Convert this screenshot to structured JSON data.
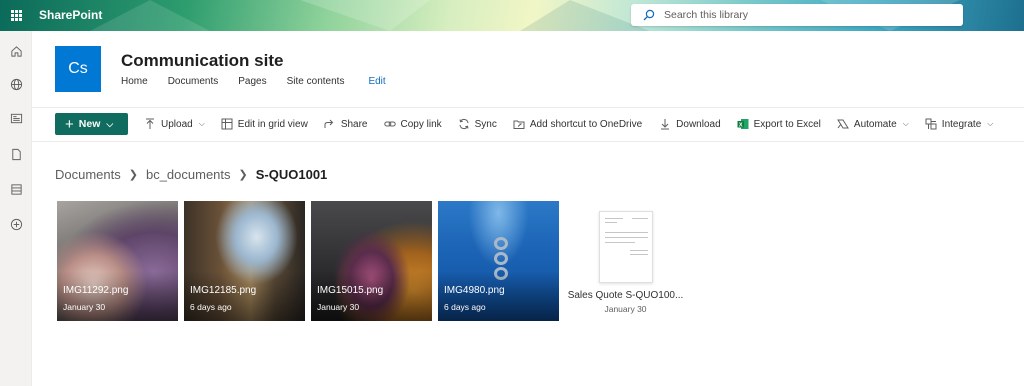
{
  "suite": {
    "brand": "SharePoint",
    "search_placeholder": "Search this library"
  },
  "site": {
    "logo": "Cs",
    "title": "Communication site",
    "nav": [
      "Home",
      "Documents",
      "Pages",
      "Site contents"
    ],
    "edit": "Edit"
  },
  "toolbar": {
    "new": "New",
    "upload": "Upload",
    "grid_view": "Edit in grid view",
    "share": "Share",
    "copy_link": "Copy link",
    "sync": "Sync",
    "add_shortcut": "Add shortcut to OneDrive",
    "download": "Download",
    "export_excel": "Export to Excel",
    "automate": "Automate",
    "integrate": "Integrate"
  },
  "breadcrumb": [
    "Documents",
    "bc_documents",
    "S-QUO1001"
  ],
  "files": [
    {
      "name": "IMG11292.png",
      "date": "January 30"
    },
    {
      "name": "IMG12185.png",
      "date": "6 days ago"
    },
    {
      "name": "IMG15015.png",
      "date": "January 30"
    },
    {
      "name": "IMG4980.png",
      "date": "6 days ago"
    },
    {
      "name": "Sales Quote S-QUO100...",
      "date": "January 30"
    }
  ],
  "colors": {
    "accent": "#0f6c5f",
    "logo": "#0078d4",
    "link": "#0f6cbd"
  },
  "icons": [
    "waffle-icon",
    "search-icon",
    "home-icon",
    "globe-icon",
    "news-icon",
    "page-icon",
    "list-icon",
    "create-icon",
    "upload-icon",
    "grid-icon",
    "share-icon",
    "link-icon",
    "sync-icon",
    "shortcut-icon",
    "download-icon",
    "excel-icon",
    "automate-icon",
    "integrate-icon"
  ]
}
